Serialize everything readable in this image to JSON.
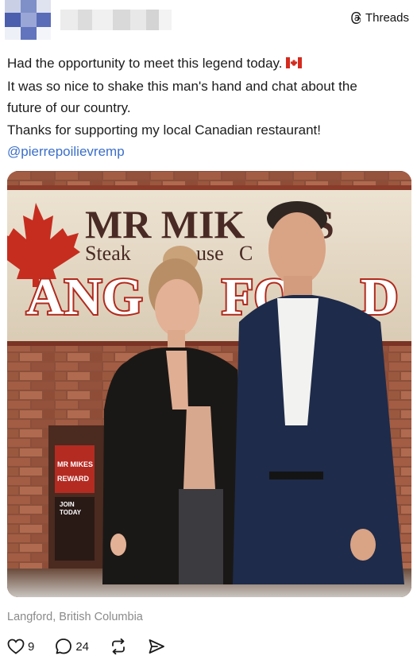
{
  "header": {
    "platform_label": "Threads",
    "icons": {
      "platform": "threads-logo-icon"
    }
  },
  "post": {
    "lines": [
      "Had the opportunity to meet this legend today.",
      "It was so nice to shake this man's hand and chat about the",
      "future of our country.",
      "Thanks for supporting my local Canadian restaurant!"
    ],
    "mention": "@pierrepoilievremp",
    "flag_icon": "canada-flag-icon"
  },
  "photo": {
    "sign_line1": "MR MIK",
    "sign_line1_end": "S",
    "sign_line2": "Steak",
    "sign_line2_mid": "use",
    "sign_line2_end": "C",
    "sign_line3": "ANG",
    "sign_line3_end": "FO",
    "sign_line3_tail": "D",
    "stand_logo": "MR MIKES",
    "stand_rewards": "REWARD",
    "stand_join": "JOIN",
    "stand_today": "TODAY"
  },
  "location": "Langford, British Columbia",
  "actions": {
    "likes": "9",
    "comments": "24",
    "icons": [
      "heart-icon",
      "comment-icon",
      "repost-icon",
      "share-icon"
    ]
  }
}
